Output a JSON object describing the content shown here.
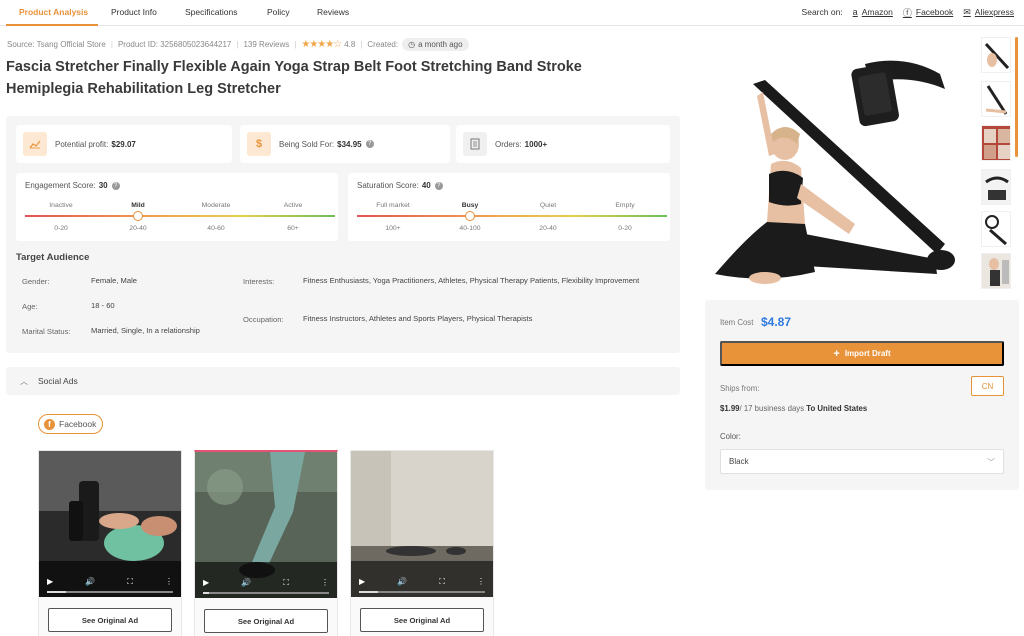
{
  "tabs": [
    {
      "label": "Product Analysis",
      "active": true
    },
    {
      "label": "Product Info"
    },
    {
      "label": "Specifications"
    },
    {
      "label": "Policy"
    },
    {
      "label": "Reviews"
    }
  ],
  "search_on": {
    "label": "Search on:",
    "links": [
      {
        "icon": "amazon-icon",
        "label": "Amazon"
      },
      {
        "icon": "facebook-icon",
        "label": "Facebook"
      },
      {
        "icon": "mail-icon",
        "label": "Aliexpress"
      }
    ]
  },
  "meta": {
    "source": "Source: Tsang Official Store",
    "product_id": "Product ID: 3256805023644217",
    "reviews": "139 Reviews",
    "rating": "4.8",
    "created_label": "Created:",
    "created_value": "a month ago"
  },
  "title": "Fascia Stretcher Finally Flexible Again Yoga Strap Belt Foot Stretching Band Stroke Hemiplegia Rehabilitation Leg Stretcher",
  "metrics": {
    "profit_label": "Potential profit:",
    "profit_value": "$29.07",
    "sold_label": "Being Sold For:",
    "sold_value": "$34.95",
    "orders_label": "Orders:",
    "orders_value": "1000+"
  },
  "engagement": {
    "label": "Engagement Score:",
    "value": "30",
    "levels": [
      "Inactive",
      "Mild",
      "Moderate",
      "Active"
    ],
    "ranges": [
      "0-20",
      "20-40",
      "40-60",
      "60+"
    ]
  },
  "saturation": {
    "label": "Saturation Score:",
    "value": "40",
    "levels": [
      "Full market",
      "Busy",
      "Quiet",
      "Empty"
    ],
    "ranges": [
      "100+",
      "40-100",
      "20-40",
      "0-20"
    ]
  },
  "audience": {
    "title": "Target Audience",
    "gender_label": "Gender:",
    "gender": "Female, Male",
    "age_label": "Age:",
    "age": "18 - 60",
    "marital_label": "Marital Status:",
    "marital": "Married, Single, In a relationship",
    "interests_label": "Interests:",
    "interests": "Fitness Enthusiasts, Yoga Practitioners, Athletes, Physical Therapy Patients, Flexibility Improvement",
    "occupation_label": "Occupation:",
    "occupation": "Fitness Instructors, Athletes and Sports Players, Physical Therapists"
  },
  "social": {
    "title": "Social Ads",
    "platform": "Facebook",
    "see_label": "See Original Ad"
  },
  "right": {
    "cost_label": "Item Cost",
    "cost_value": "$4.87",
    "import_label": "Import Draft",
    "ships_label": "Ships from:",
    "ships_country": "CN",
    "ship_price": "$1.99",
    "ship_days": "/ 17 business days",
    "ship_dest": "To United States",
    "color_label": "Color:",
    "color_value": "Black"
  },
  "colors": {
    "accent": "#e8923a",
    "link": "#2f7ae0"
  }
}
